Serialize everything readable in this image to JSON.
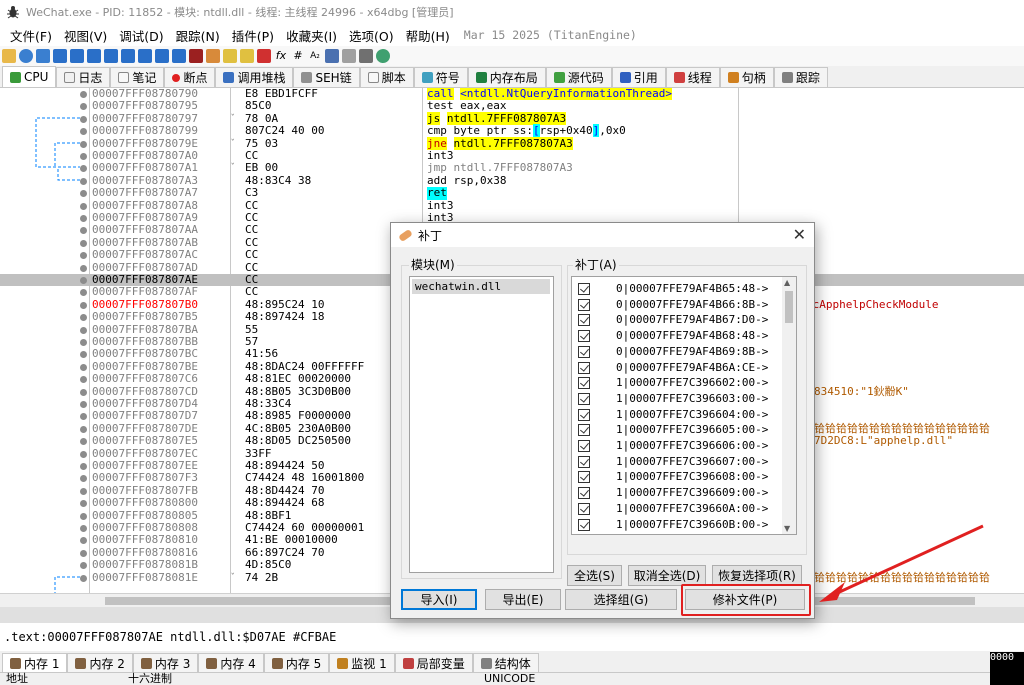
{
  "window": {
    "title": "WeChat.exe - PID: 11852 - 模块: ntdll.dll - 线程: 主线程 24996 - x64dbg [管理员]"
  },
  "menu": {
    "items": [
      "文件(F)",
      "视图(V)",
      "调试(D)",
      "跟踪(N)",
      "插件(P)",
      "收藏夹(I)",
      "选项(O)",
      "帮助(H)"
    ],
    "build_date": "Mar 15 2025 (TitanEngine)"
  },
  "tabs": [
    "CPU",
    "日志",
    "笔记",
    "断点",
    "调用堆栈",
    "SEH链",
    "脚本",
    "符号",
    "内存布局",
    "源代码",
    "引用",
    "线程",
    "句柄",
    "跟踪"
  ],
  "disasm": {
    "rows": [
      {
        "addr": "00007FFF08780790",
        "bytes": "E8 EBD1FCFF"
      },
      {
        "addr": "00007FFF08780795",
        "bytes": "85C0"
      },
      {
        "addr": "00007FFF08780797",
        "bytes": "78 0A"
      },
      {
        "addr": "00007FFF08780799",
        "bytes": "807C24 40 00"
      },
      {
        "addr": "00007FFF0878079E",
        "bytes": "75 03"
      },
      {
        "addr": "00007FFF087807A0",
        "bytes": "CC"
      },
      {
        "addr": "00007FFF087807A1",
        "bytes": "EB 00"
      },
      {
        "addr": "00007FFF087807A3",
        "bytes": "48:83C4 38"
      },
      {
        "addr": "00007FFF087807A7",
        "bytes": "C3"
      },
      {
        "addr": "00007FFF087807A8",
        "bytes": "CC"
      },
      {
        "addr": "00007FFF087807A9",
        "bytes": "CC"
      },
      {
        "addr": "00007FFF087807AA",
        "bytes": "CC"
      },
      {
        "addr": "00007FFF087807AB",
        "bytes": "CC"
      },
      {
        "addr": "00007FFF087807AC",
        "bytes": "CC"
      },
      {
        "addr": "00007FFF087807AD",
        "bytes": "CC"
      },
      {
        "addr": "00007FFF087807AE",
        "bytes": "CC"
      },
      {
        "addr": "00007FFF087807AF",
        "bytes": "CC"
      },
      {
        "addr": "00007FFF087807B0",
        "bytes": "48:895C24 10"
      },
      {
        "addr": "00007FFF087807B5",
        "bytes": "48:897424 18"
      },
      {
        "addr": "00007FFF087807BA",
        "bytes": "55"
      },
      {
        "addr": "00007FFF087807BB",
        "bytes": "57"
      },
      {
        "addr": "00007FFF087807BC",
        "bytes": "41:56"
      },
      {
        "addr": "00007FFF087807BE",
        "bytes": "48:8DAC24 00FFFFFF"
      },
      {
        "addr": "00007FFF087807C6",
        "bytes": "48:81EC 00020000"
      },
      {
        "addr": "00007FFF087807CD",
        "bytes": "48:8B05 3C3D0B00"
      },
      {
        "addr": "00007FFF087807D4",
        "bytes": "48:33C4"
      },
      {
        "addr": "00007FFF087807D7",
        "bytes": "48:8985 F0000000"
      },
      {
        "addr": "00007FFF087807DE",
        "bytes": "4C:8B05 230A0B00"
      },
      {
        "addr": "00007FFF087807E5",
        "bytes": "48:8D05 DC250500"
      },
      {
        "addr": "00007FFF087807EC",
        "bytes": "33FF"
      },
      {
        "addr": "00007FFF087807EE",
        "bytes": "48:894424 50"
      },
      {
        "addr": "00007FFF087807F3",
        "bytes": "C74424 48 16001800"
      },
      {
        "addr": "00007FFF087807FB",
        "bytes": "48:8D4424 70"
      },
      {
        "addr": "00007FFF08780800",
        "bytes": "48:894424 68"
      },
      {
        "addr": "00007FFF08780805",
        "bytes": "48:8BF1"
      },
      {
        "addr": "00007FFF08780808",
        "bytes": "C74424 60 00000001"
      },
      {
        "addr": "00007FFF08780810",
        "bytes": "41:BE 00010000"
      },
      {
        "addr": "00007FFF08780816",
        "bytes": "66:897C24 70"
      },
      {
        "addr": "00007FFF0878081B",
        "bytes": "4D:85C0"
      },
      {
        "addr": "00007FFF0878081E",
        "bytes": "74 2B"
      }
    ],
    "asm": {
      "r0_mn": "call",
      "r0_op": "<ntdll.NtQueryInformationThread>",
      "r1": "test eax,eax",
      "r2_mn": "js",
      "r2_op": "ntdll.7FFF087807A3",
      "r3_a": "cmp byte ptr ss:",
      "r3_b": "[",
      "r3_c": "rsp+0x40",
      "r3_d": "]",
      "r3_e": ",0x0",
      "r4_mn": "jne",
      "r4_op": "ntdll.7FFF087807A3",
      "r5": "int3",
      "r6": "jmp ntdll.7FFF087807A3",
      "r7": "add rsp,0x38",
      "r8": "ret",
      "r9": "int3",
      "r10": "int3"
    },
    "comments": {
      "c17": "ocApphelpCheckModule",
      "c24": "834510:\"1鈥黺K\"",
      "c27": "铪铪铪铪铪铪铪铪铪铪铪铪铪铪铪铪",
      "c28": "7D2DC8:L\"apphelp.dll\"",
      "c39": "铪铪铪铪铪铪铪铪铪铪铪铪铪铪铪铪"
    }
  },
  "info_line": ".text:00007FFF087807AE ntdll.dll:$D07AE #CFBAE",
  "bottom_tabs": [
    "内存 1",
    "内存 2",
    "内存 3",
    "内存 4",
    "内存 5",
    "监视 1",
    "局部变量",
    "结构体"
  ],
  "dump_header": {
    "addr": "地址",
    "hex": "十六进制",
    "ascii": "UNICODE"
  },
  "stack_box": "0000",
  "dialog": {
    "title": "补丁",
    "modules_label": "模块(M)",
    "patches_label": "补丁(A)",
    "modules": [
      "wechatwin.dll"
    ],
    "patches": [
      "0|00007FFE79AF4B65:48->",
      "0|00007FFE79AF4B66:8B->",
      "0|00007FFE79AF4B67:D0->",
      "0|00007FFE79AF4B68:48->",
      "0|00007FFE79AF4B69:8B->",
      "0|00007FFE79AF4B6A:CE->",
      "1|00007FFE7C396602:00->",
      "1|00007FFE7C396603:00->",
      "1|00007FFE7C396604:00->",
      "1|00007FFE7C396605:00->",
      "1|00007FFE7C396606:00->",
      "1|00007FFE7C396607:00->",
      "1|00007FFE7C396608:00->",
      "1|00007FFE7C396609:00->",
      "1|00007FFE7C39660A:00->",
      "1|00007FFE7C39660B:00->"
    ],
    "btn_select_all": "全选(S)",
    "btn_deselect_all": "取消全选(D)",
    "btn_restore": "恢复选择项(R)",
    "btn_import": "导入(I)",
    "btn_export": "导出(E)",
    "btn_select_group": "选择组(G)",
    "btn_patch_file": "修补文件(P)"
  }
}
